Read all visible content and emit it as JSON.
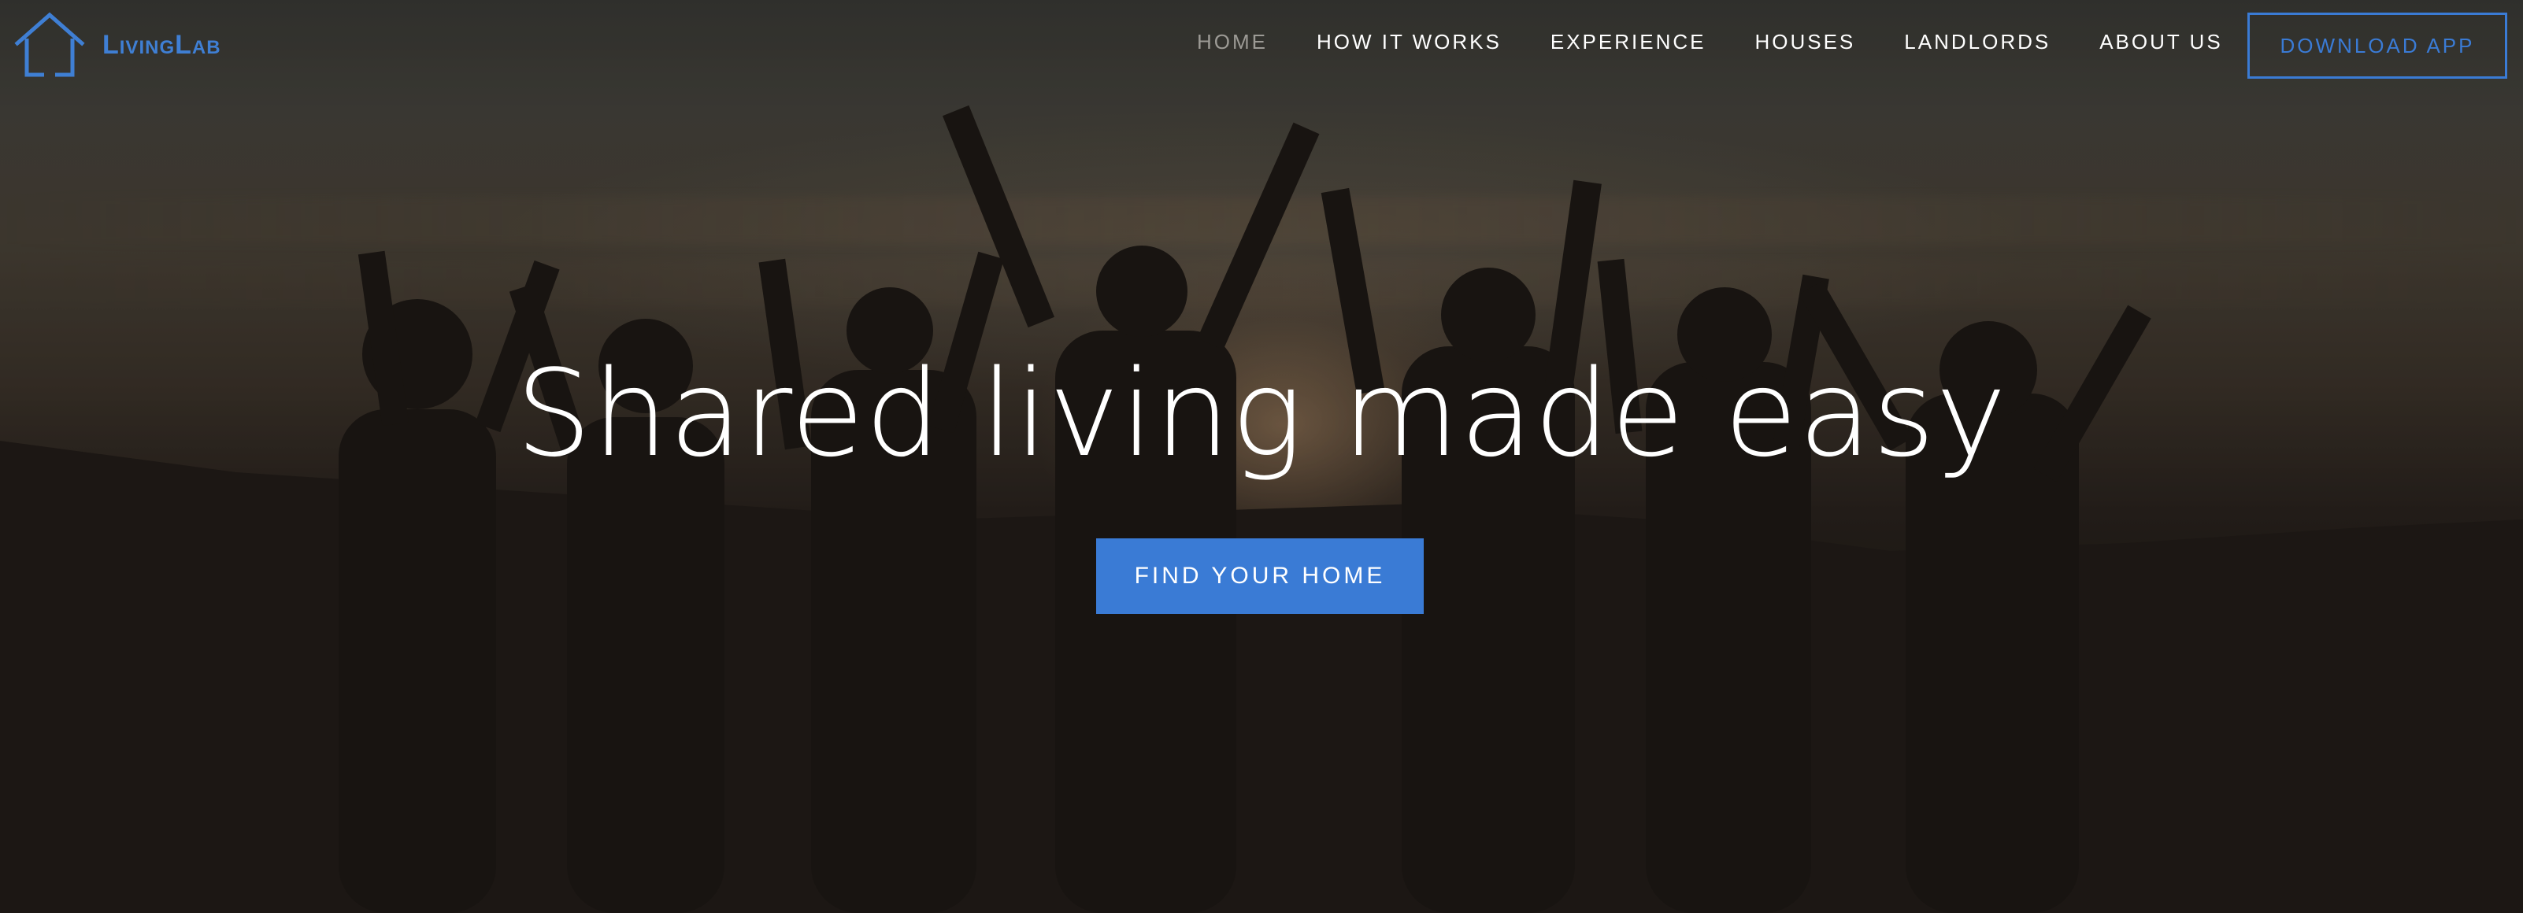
{
  "brand": {
    "name": "LivingLab",
    "logo_icon": "house-outline-icon",
    "color": "#3f7fd4"
  },
  "nav": {
    "items": [
      {
        "label": "HOME",
        "active": true
      },
      {
        "label": "HOW IT WORKS",
        "active": false
      },
      {
        "label": "EXPERIENCE",
        "active": false
      },
      {
        "label": "HOUSES",
        "active": false
      },
      {
        "label": "LANDLORDS",
        "active": false
      },
      {
        "label": "ABOUT US",
        "active": false
      }
    ],
    "download_label": "DOWNLOAD APP"
  },
  "hero": {
    "headline": "Shared living made easy",
    "cta_label": "FIND YOUR HOME",
    "background_image": "silhouettes-of-people-raising-hands-at-sunset",
    "accent_color": "#3a7bd5"
  }
}
